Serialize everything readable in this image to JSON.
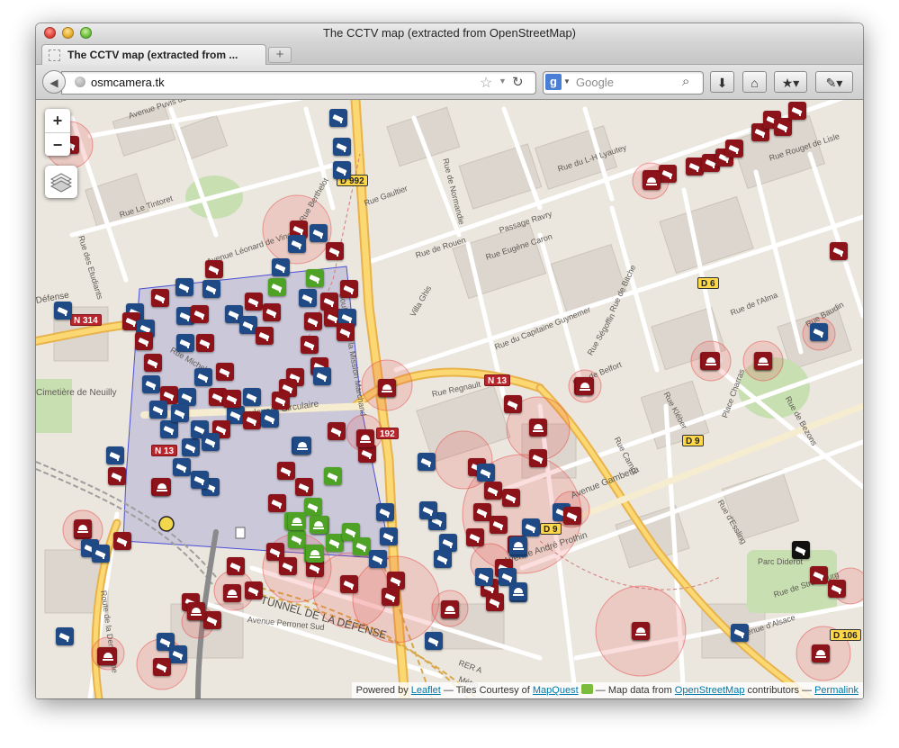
{
  "window": {
    "title": "The CCTV map (extracted from OpenStreetMap)"
  },
  "tabs": [
    {
      "label": "The CCTV map (extracted from ..."
    }
  ],
  "toolbar": {
    "new_tab_label": "+",
    "back_icon": "back-arrow-icon",
    "url": "osmcamera.tk",
    "search_engine": "Google",
    "search_placeholder": "Google",
    "google_letter": "g"
  },
  "map": {
    "zoom_in_label": "+",
    "zoom_out_label": "−",
    "attribution": {
      "powered_by": "Powered by ",
      "leaflet": "Leaflet",
      "tiles": " — Tiles Courtesy of ",
      "mapquest": "MapQuest",
      "map_data": " — Map data from ",
      "osm": "OpenStreetMap",
      "contributors": " contributors — ",
      "permalink": "Permalink"
    },
    "road_labels": [
      "Avenue Puvis de Chavannes",
      "Rue Le Tintoret",
      "Rue des Etudiants",
      "Avenue Léonard de Vinci",
      "Rue Berthelot",
      "Boulevard de la Mission Marchand",
      "Rue Gaultier",
      "Rue de Normandie",
      "Passage Ravry",
      "Rue Eugène Caron",
      "Rue de Rouen",
      "Rue du L-H Lyautey",
      "Rue Rouget de Lisle",
      "Villa Ghis",
      "Rue du Capitaine Guynemer",
      "Rue de Bitche",
      "Rue Ségoffin",
      "Rue de Belfort",
      "Rue de l'Alma",
      "Rue Baudin",
      "Rue Regnault",
      "Rue Kléber",
      "Rue Carnot",
      "Place Charras",
      "Rue de Bezons",
      "Boulevard Circulaire",
      "Avenue Gambetta",
      "Rue d'Essling",
      "Avenue André Prothin",
      "Parc Diderot",
      "Rue de Strasbourg",
      "Avenue d'Alsace",
      "TUNNEL DE LA DÉFENSE",
      "Avenue Perronet Sud",
      "Route de la Demi-Lune",
      "Cimetière de Neuilly",
      "Défense",
      "Rue Michelet",
      "RER A",
      "Métro"
    ],
    "shields": [
      "D 992",
      "D 6",
      "N 314",
      "N 13",
      "N 13",
      "192",
      "D 9",
      "D 9",
      "D 106"
    ]
  }
}
